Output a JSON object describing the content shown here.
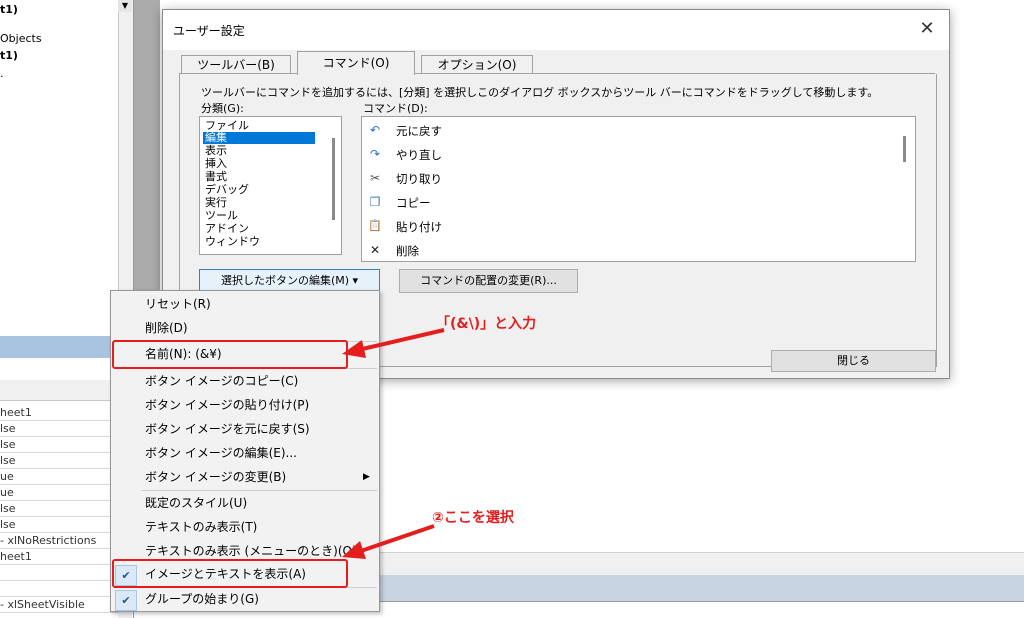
{
  "background": {
    "tree_items": [
      "t1)",
      "Objects",
      "t1)",
      "."
    ],
    "property_rows": [
      "heet1",
      "lse",
      "lse",
      "lse",
      "ue",
      "ue",
      "lse",
      "lse",
      "- xlNoRestrictions",
      "heet1",
      "",
      "",
      "- xlSheetVisible"
    ]
  },
  "dialog": {
    "title": "ユーザー設定",
    "close_glyph": "✕",
    "tabs": [
      {
        "label": "ツールバー(B)"
      },
      {
        "label": "コマンド(O)"
      },
      {
        "label": "オプション(O)"
      }
    ],
    "instruction": "ツールバーにコマンドを追加するには、[分類] を選択しこのダイアログ ボックスからツール バーにコマンドをドラッグして移動します。",
    "category_label": "分類(G):",
    "command_label": "コマンド(D):",
    "categories": [
      "ファイル",
      "編集",
      "表示",
      "挿入",
      "書式",
      "デバッグ",
      "実行",
      "ツール",
      "アドイン",
      "ウィンドウ"
    ],
    "selected_category": "編集",
    "commands": [
      {
        "icon": "undo-icon",
        "glyph": "↶",
        "label": "元に戻す"
      },
      {
        "icon": "redo-icon",
        "glyph": "↷",
        "label": "やり直し"
      },
      {
        "icon": "scissors-icon",
        "glyph": "✂",
        "label": "切り取り"
      },
      {
        "icon": "copy-icon",
        "glyph": "❐",
        "label": "コピー"
      },
      {
        "icon": "paste-icon",
        "glyph": "📋",
        "label": "貼り付け"
      },
      {
        "icon": "delete-icon",
        "glyph": "✕",
        "label": "削除"
      }
    ],
    "edit_button_label": "選択したボタンの編集(M) ▾",
    "rearrange_button_label": "コマンドの配置の変更(R)...",
    "close_button_label": "閉じる"
  },
  "menu": {
    "items": [
      {
        "label": "リセット(R)"
      },
      {
        "label": "削除(D)"
      },
      {
        "label": "名前(N):  (&¥)"
      },
      {
        "label": "ボタン イメージのコピー(C)"
      },
      {
        "label": "ボタン イメージの貼り付け(P)"
      },
      {
        "label": "ボタン イメージを元に戻す(S)"
      },
      {
        "label": "ボタン イメージの編集(E)..."
      },
      {
        "label": "ボタン イメージの変更(B)",
        "submenu_glyph": "▶"
      },
      {
        "label": "既定のスタイル(U)"
      },
      {
        "label": "テキストのみ表示(T)"
      },
      {
        "label": "テキストのみ表示 (メニューのとき)(O)"
      },
      {
        "label": "イメージとテキストを表示(A)",
        "checked": true
      },
      {
        "label": "グループの始まり(G)",
        "checked": true
      }
    ],
    "check_glyph": "✔"
  },
  "annotations": {
    "note1": "「(&\\)」と入力",
    "note2": "②ここを選択",
    "color": "#e51d1d"
  }
}
